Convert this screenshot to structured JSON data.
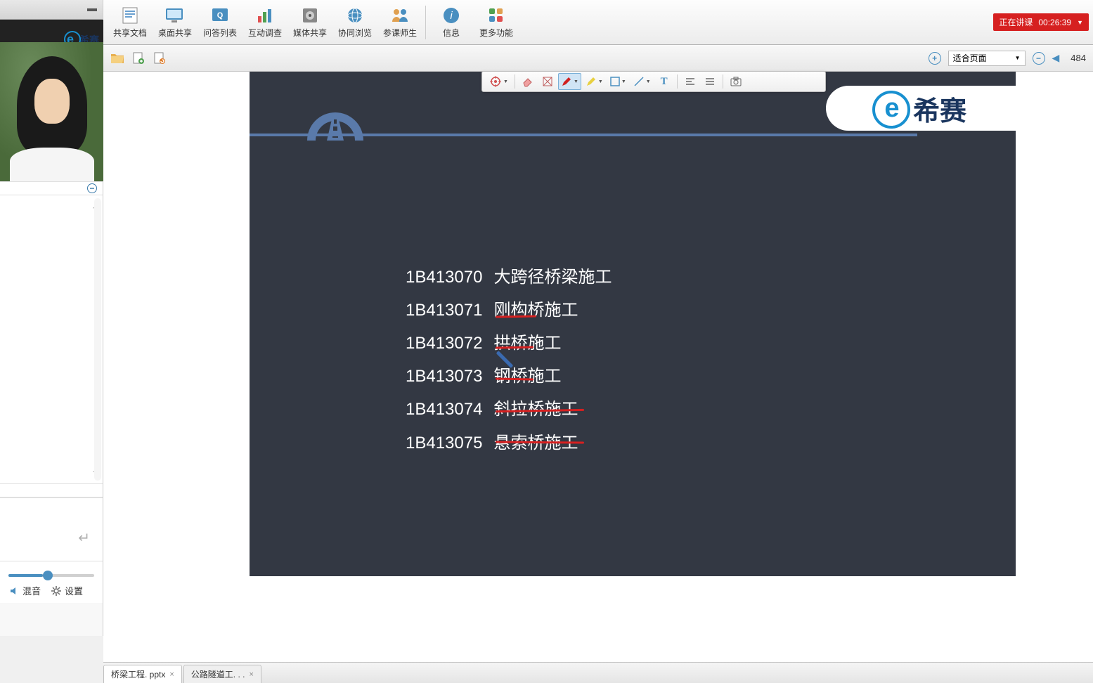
{
  "brand": {
    "e": "e",
    "name": "希赛"
  },
  "toolbar": {
    "items": [
      {
        "label": "共享文档",
        "icon": "doc"
      },
      {
        "label": "桌面共享",
        "icon": "desktop"
      },
      {
        "label": "问答列表",
        "icon": "qa"
      },
      {
        "label": "互动调查",
        "icon": "chart"
      },
      {
        "label": "媒体共享",
        "icon": "media"
      },
      {
        "label": "协同浏览",
        "icon": "globe"
      },
      {
        "label": "参课师生",
        "icon": "people"
      },
      {
        "label": "信息",
        "icon": "info"
      },
      {
        "label": "更多功能",
        "icon": "grid"
      }
    ],
    "status_label": "正在讲课",
    "status_time": "00:26:39"
  },
  "subtoolbar": {
    "zoom_mode": "适合页面",
    "zoom_value": "484"
  },
  "mixer": {
    "mix": "混音",
    "settings": "设置"
  },
  "slide": {
    "rows": [
      {
        "code": "1B413070",
        "title": "大跨径桥梁施工"
      },
      {
        "code": "1B413071",
        "title": "刚构桥施工"
      },
      {
        "code": "1B413072",
        "title": "拱桥施工"
      },
      {
        "code": "1B413073",
        "title": "钢桥施工"
      },
      {
        "code": "1B413074",
        "title": "斜拉桥施工"
      },
      {
        "code": "1B413075",
        "title": "悬索桥施工"
      }
    ]
  },
  "tabs": [
    {
      "label": "桥梁工程. pptx",
      "active": true
    },
    {
      "label": "公路隧道工. . .",
      "active": false
    }
  ]
}
